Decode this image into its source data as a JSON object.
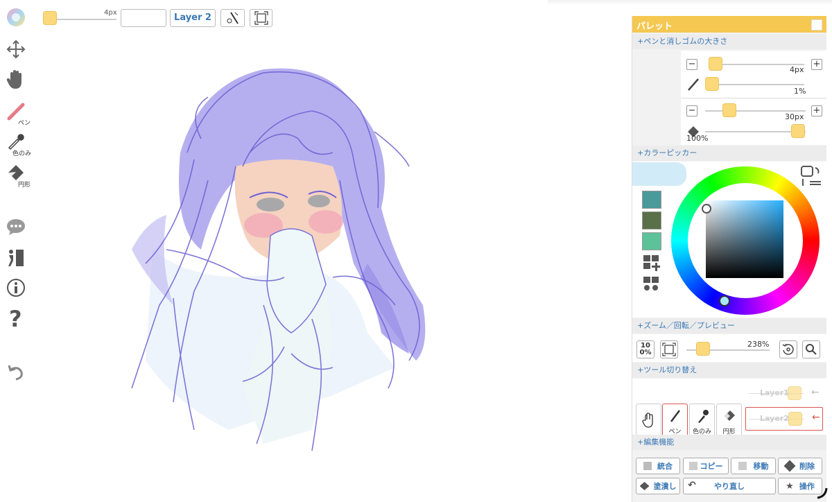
{
  "toolbar": {
    "brush_size": "4px",
    "layer_label": "Layer 2"
  },
  "left_tools": {
    "pen_label": "ペン",
    "eyedropper_label": "色のみ",
    "eraser_label": "円形"
  },
  "palette": {
    "title": "パレット",
    "pen_section": {
      "title": "+ペンと消しゴムの大きさ",
      "pen_size": "4px",
      "pen_opacity": "1%",
      "eraser_size": "30px",
      "eraser_opacity": "100%"
    },
    "color_section": {
      "title": "+カラーピッカー",
      "swatches": [
        "#4a9a9a",
        "#5a7048",
        "#5cc29a"
      ]
    },
    "zoom_section": {
      "title": "+ズーム／回転／プレビュー",
      "zoom_reset": "100%",
      "zoom_value": "238%"
    },
    "tool_section": {
      "title": "+ツール切り替え",
      "pen": "ペン",
      "eyedropper": "色のみ",
      "eraser": "円形",
      "layer1": "Layer1",
      "layer2": "Layer2"
    },
    "edit_section": {
      "title": "+編集機能",
      "merge": "統合",
      "copy": "コピー",
      "move": "移動",
      "delete": "削除",
      "fill": "塗潰し",
      "redo": "やり直し",
      "operate": "操作"
    }
  }
}
